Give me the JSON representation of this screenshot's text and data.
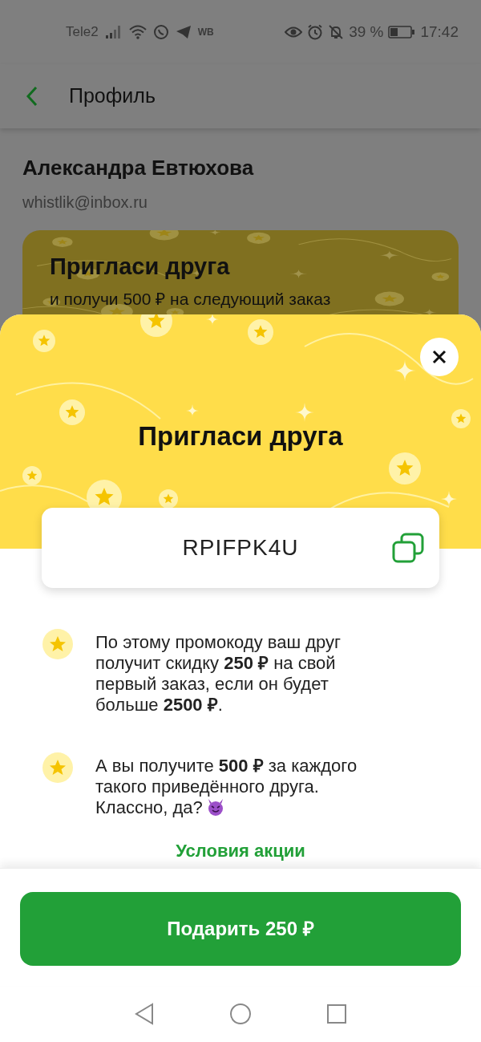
{
  "status_bar": {
    "carrier": "Tele2",
    "network_badge": "WB",
    "battery": "39 %",
    "time": "17:42"
  },
  "header": {
    "title": "Профиль"
  },
  "profile": {
    "name": "Александра Евтюхова",
    "email": "whistlik@inbox.ru"
  },
  "promo_card": {
    "title": "Пригласи друга",
    "subtitle": "и получи 500 ₽ на следующий заказ"
  },
  "sheet": {
    "title": "Пригласи друга",
    "promo_code": "RPIFPK4U",
    "bullets": [
      {
        "kind": "plain",
        "text": "По этому промокоду ваш друг получит скидку **250 ₽** на свой первый заказ, если он будет больше **2500 ₽**."
      },
      {
        "kind": "emoji",
        "text": "А вы получите **500 ₽** за каждого такого приведённого друга. Классно, да?"
      }
    ],
    "terms_link": "Условия акции"
  },
  "action_button": "Подарить 250 ₽"
}
